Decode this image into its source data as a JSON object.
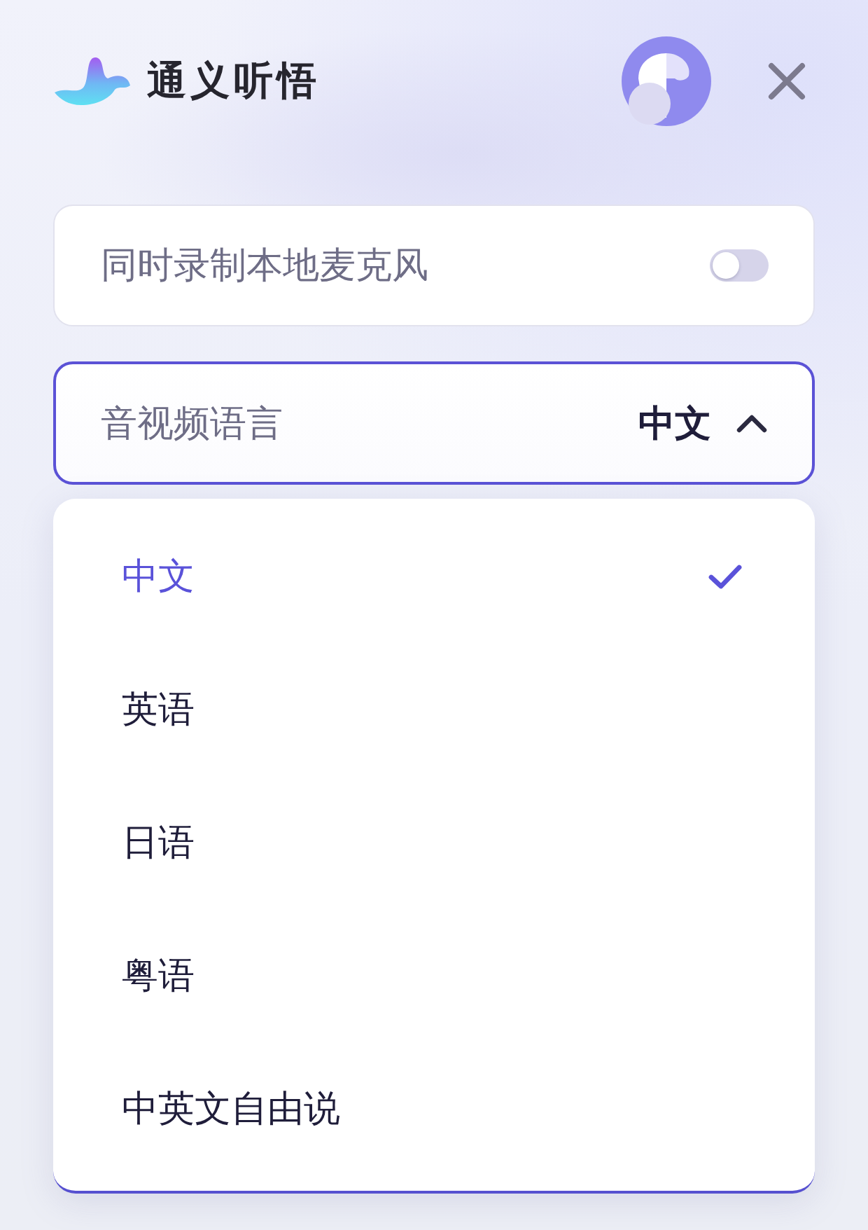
{
  "app": {
    "title": "通义听悟"
  },
  "mic_toggle": {
    "label": "同时录制本地麦克风",
    "on": false
  },
  "language_select": {
    "label": "音视频语言",
    "value": "中文",
    "expanded": true
  },
  "language_options": [
    {
      "label": "中文",
      "selected": true
    },
    {
      "label": "英语",
      "selected": false
    },
    {
      "label": "日语",
      "selected": false
    },
    {
      "label": "粤语",
      "selected": false
    },
    {
      "label": "中英文自由说",
      "selected": false
    }
  ]
}
